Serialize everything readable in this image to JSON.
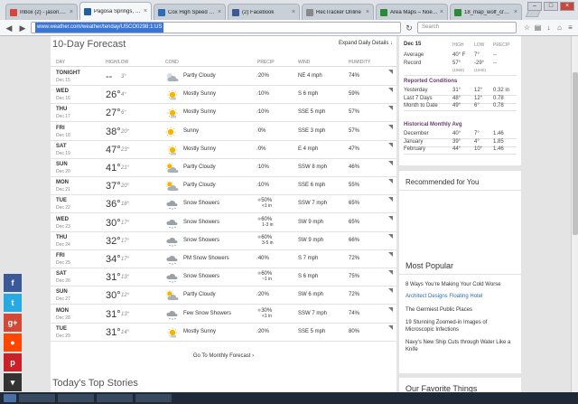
{
  "browser": {
    "tabs": [
      {
        "label": "Inbox (2) - jason.ales...",
        "color": "#d44638",
        "active": false
      },
      {
        "label": "Pagosa Springs, CO ...",
        "color": "#1f5fa8",
        "active": true
      },
      {
        "label": "Cox High Speed Inte...",
        "color": "#2d6db5",
        "active": false
      },
      {
        "label": "(2) Facebook",
        "color": "#3b5998",
        "active": false
      },
      {
        "label": "RecTracker Online",
        "color": "#888888",
        "active": false
      },
      {
        "label": "Area Maps – Noel Sp...",
        "color": "#2a8a3a",
        "active": false
      },
      {
        "label": "18_map_wolf_creek_...",
        "color": "#2a8a3a",
        "active": false
      }
    ],
    "url": "www.weather.com/weather/tenday/USCO0298:1:US",
    "search_placeholder": "Search"
  },
  "forecast": {
    "title": "10-Day Forecast",
    "expand_label": "Expand Daily Details",
    "headers": {
      "day": "DAY",
      "hilo": "HIGH/LOW",
      "cond": "COND",
      "precip": "PRECIP",
      "wind": "WIND",
      "humidity": "HUMIDITY"
    },
    "rows": [
      {
        "day": "TONIGHT",
        "date": "Dec 15",
        "hi": "--",
        "lo": "3°",
        "icon": "partly-cloudy-night",
        "cond": "Partly Cloudy",
        "precip": "20%",
        "precip2": "",
        "wind": "NE 4 mph",
        "hum": "74%"
      },
      {
        "day": "WED",
        "date": "Dec 16",
        "hi": "26°",
        "lo": "4°",
        "icon": "mostly-sunny",
        "cond": "Mostly Sunny",
        "precip": "10%",
        "precip2": "",
        "wind": "S 6 mph",
        "hum": "59%"
      },
      {
        "day": "THU",
        "date": "Dec 17",
        "hi": "27°",
        "lo": "6°",
        "icon": "mostly-sunny",
        "cond": "Mostly Sunny",
        "precip": "10%",
        "precip2": "",
        "wind": "SSE 5 mph",
        "hum": "57%"
      },
      {
        "day": "FRI",
        "date": "Dec 18",
        "hi": "38°",
        "lo": "20°",
        "icon": "sunny",
        "cond": "Sunny",
        "precip": "0%",
        "precip2": "",
        "wind": "SSE 3 mph",
        "hum": "57%"
      },
      {
        "day": "SAT",
        "date": "Dec 19",
        "hi": "47°",
        "lo": "23°",
        "icon": "mostly-sunny",
        "cond": "Mostly Sunny",
        "precip": "0%",
        "precip2": "",
        "wind": "E 4 mph",
        "hum": "47%"
      },
      {
        "day": "SUN",
        "date": "Dec 20",
        "hi": "41°",
        "lo": "21°",
        "icon": "partly-cloudy",
        "cond": "Partly Cloudy",
        "precip": "10%",
        "precip2": "",
        "wind": "SSW 8 mph",
        "hum": "46%"
      },
      {
        "day": "MON",
        "date": "Dec 21",
        "hi": "37°",
        "lo": "20°",
        "icon": "partly-cloudy",
        "cond": "Partly Cloudy",
        "precip": "10%",
        "precip2": "",
        "wind": "SSE 6 mph",
        "hum": "55%"
      },
      {
        "day": "TUE",
        "date": "Dec 22",
        "hi": "36°",
        "lo": "18°",
        "icon": "snow-showers",
        "cond": "Snow Showers",
        "precip": "50%",
        "precip2": "<1 in",
        "wind": "SSW 7 mph",
        "hum": "65%"
      },
      {
        "day": "WED",
        "date": "Dec 23",
        "hi": "30°",
        "lo": "17°",
        "icon": "snow-showers",
        "cond": "Snow Showers",
        "precip": "60%",
        "precip2": "1-3 in",
        "wind": "SW 9 mph",
        "hum": "65%"
      },
      {
        "day": "THU",
        "date": "Dec 24",
        "hi": "32°",
        "lo": "17°",
        "icon": "snow-showers",
        "cond": "Snow Showers",
        "precip": "60%",
        "precip2": "3-5 in",
        "wind": "SW 9 mph",
        "hum": "66%"
      },
      {
        "day": "FRI",
        "date": "Dec 25",
        "hi": "34°",
        "lo": "17°",
        "icon": "snow-showers",
        "cond": "PM Snow Showers",
        "precip": "40%",
        "precip2": "",
        "wind": "S 7 mph",
        "hum": "72%"
      },
      {
        "day": "SAT",
        "date": "Dec 26",
        "hi": "31°",
        "lo": "13°",
        "icon": "snow-showers",
        "cond": "Snow Showers",
        "precip": "60%",
        "precip2": "~1 in",
        "wind": "S 6 mph",
        "hum": "75%"
      },
      {
        "day": "SUN",
        "date": "Dec 27",
        "hi": "30°",
        "lo": "12°",
        "icon": "partly-cloudy",
        "cond": "Partly Cloudy",
        "precip": "20%",
        "precip2": "",
        "wind": "SW 6 mph",
        "hum": "72%"
      },
      {
        "day": "MON",
        "date": "Dec 28",
        "hi": "31°",
        "lo": "13°",
        "icon": "snow-showers",
        "cond": "Few Snow Showers",
        "precip": "30%",
        "precip2": "<1 in",
        "wind": "SSW 7 mph",
        "hum": "74%"
      },
      {
        "day": "TUE",
        "date": "Dec 29",
        "hi": "31°",
        "lo": "14°",
        "icon": "mostly-sunny",
        "cond": "Mostly Sunny",
        "precip": "20%",
        "precip2": "",
        "wind": "SSE 5 mph",
        "hum": "80%"
      }
    ],
    "monthly_link": "Go To Monthly Forecast",
    "top_stories": "Today's Top Stories"
  },
  "sidebar": {
    "date": "Dec 15",
    "cols": {
      "high": "HIGH",
      "low": "LOW",
      "precip": "PRECIP"
    },
    "average": {
      "label": "Average",
      "high": "40° F",
      "low": "7°",
      "precip": "--"
    },
    "record": {
      "label": "Record",
      "high": "57°",
      "low": "-29°",
      "precip": "--",
      "high_year": "(1969)",
      "low_year": "(1945)"
    },
    "reported_title": "Reported Conditions",
    "reported": [
      {
        "label": "Yesterday",
        "high": "31°",
        "low": "12°",
        "precip": "0.32 in"
      },
      {
        "label": "Last 7 Days",
        "high": "48°",
        "low": "12°",
        "precip": "0.78"
      },
      {
        "label": "Month to Date",
        "high": "49°",
        "low": "6°",
        "precip": "0.78"
      }
    ],
    "historical_title": "Historical Monthly Avg",
    "historical": [
      {
        "label": "December",
        "high": "40°",
        "low": "7°",
        "precip": "1.46"
      },
      {
        "label": "January",
        "high": "39°",
        "low": "4°",
        "precip": "1.85"
      },
      {
        "label": "February",
        "high": "44°",
        "low": "10°",
        "precip": "1.46"
      }
    ],
    "recommended_title": "Recommended for You",
    "popular_title": "Most Popular",
    "popular": [
      "8 Ways You're Making Your Cold Worse",
      "Architect Designs Floating Hotel",
      "The Germiest Public Places",
      "19 Stunning Zoomed-in Images of Microscopic Infections",
      "Navy's New Ship Cuts through Water Like a Knife"
    ],
    "favorite_title": "Our Favorite Things"
  },
  "share": [
    {
      "icon": "facebook-icon",
      "glyph": "f",
      "color": "#3b5998"
    },
    {
      "icon": "twitter-icon",
      "glyph": "t",
      "color": "#29a9e1"
    },
    {
      "icon": "google-plus-icon",
      "glyph": "g+",
      "color": "#d34836"
    },
    {
      "icon": "reddit-icon",
      "glyph": "●",
      "color": "#ff4500"
    },
    {
      "icon": "pinterest-icon",
      "glyph": "p",
      "color": "#cb2027"
    },
    {
      "icon": "collapse-icon",
      "glyph": "▾",
      "color": "#333333"
    }
  ]
}
